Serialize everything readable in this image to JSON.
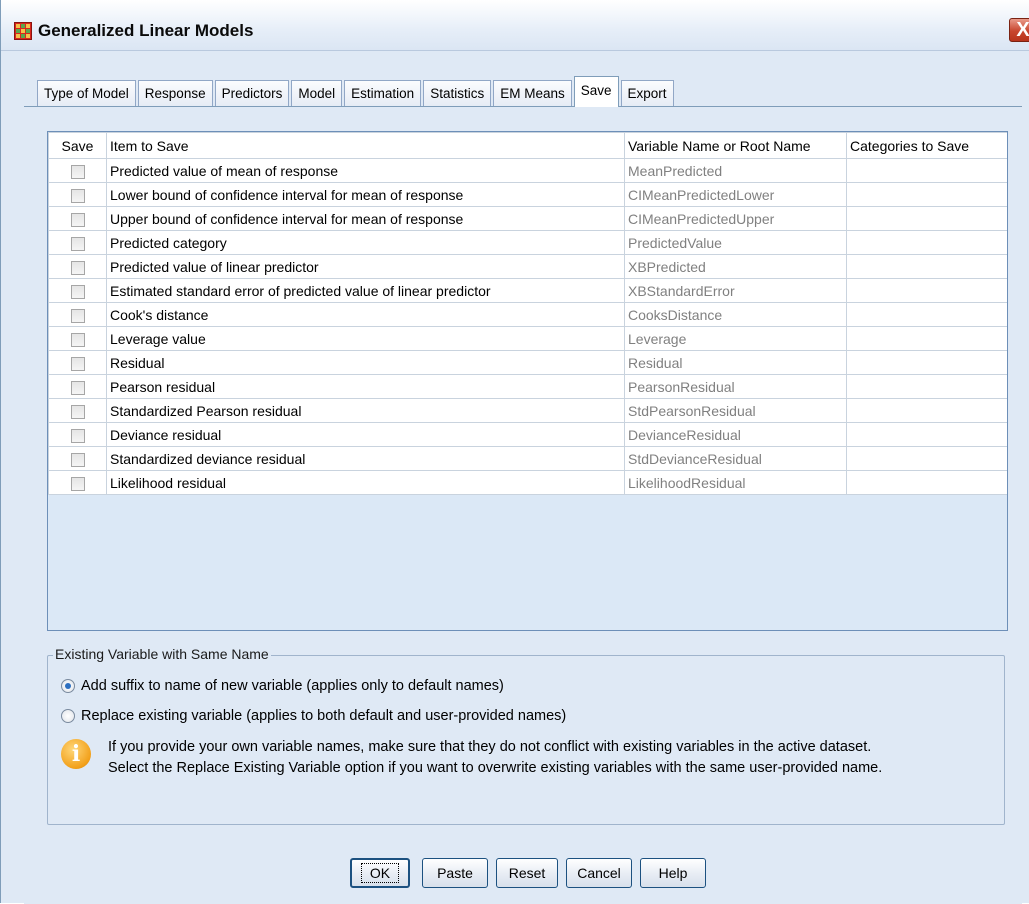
{
  "window": {
    "title": "Generalized Linear Models",
    "close_glyph": "X"
  },
  "tabs": [
    {
      "label": "Type of Model"
    },
    {
      "label": "Response"
    },
    {
      "label": "Predictors"
    },
    {
      "label": "Model"
    },
    {
      "label": "Estimation"
    },
    {
      "label": "Statistics"
    },
    {
      "label": "EM Means"
    },
    {
      "label": "Save",
      "active": true
    },
    {
      "label": "Export"
    }
  ],
  "grid": {
    "columns": [
      "Save",
      "Item to Save",
      "Variable Name or Root Name",
      "Categories to Save"
    ],
    "rows": [
      {
        "checked": false,
        "item": "Predicted value of mean of response",
        "variable": "MeanPredicted",
        "categories": ""
      },
      {
        "checked": false,
        "item": "Lower bound of confidence interval for mean of response",
        "variable": "CIMeanPredictedLower",
        "categories": ""
      },
      {
        "checked": false,
        "item": "Upper bound of confidence interval for mean of response",
        "variable": "CIMeanPredictedUpper",
        "categories": ""
      },
      {
        "checked": false,
        "item": "Predicted category",
        "variable": "PredictedValue",
        "categories": ""
      },
      {
        "checked": false,
        "item": "Predicted value of linear predictor",
        "variable": "XBPredicted",
        "categories": ""
      },
      {
        "checked": false,
        "item": "Estimated standard error of predicted value of linear predictor",
        "variable": "XBStandardError",
        "categories": ""
      },
      {
        "checked": false,
        "item": "Cook's distance",
        "variable": "CooksDistance",
        "categories": ""
      },
      {
        "checked": false,
        "item": "Leverage value",
        "variable": "Leverage",
        "categories": ""
      },
      {
        "checked": false,
        "item": "Residual",
        "variable": "Residual",
        "categories": ""
      },
      {
        "checked": false,
        "item": "Pearson residual",
        "variable": "PearsonResidual",
        "categories": ""
      },
      {
        "checked": false,
        "item": "Standardized Pearson residual",
        "variable": "StdPearsonResidual",
        "categories": ""
      },
      {
        "checked": false,
        "item": "Deviance residual",
        "variable": "DevianceResidual",
        "categories": ""
      },
      {
        "checked": false,
        "item": "Standardized deviance residual",
        "variable": "StdDevianceResidual",
        "categories": ""
      },
      {
        "checked": false,
        "item": "Likelihood residual",
        "variable": "LikelihoodResidual",
        "categories": ""
      }
    ]
  },
  "existing_variable": {
    "legend": "Existing Variable with Same Name",
    "option_add_suffix": {
      "label": "Add suffix to name of new variable (applies only to default names)",
      "selected": true
    },
    "option_replace": {
      "label": "Replace existing variable (applies to both default and user-provided names)",
      "selected": false
    },
    "info_line1": "If you provide your own variable names, make sure that they do not conflict with existing variables in the active dataset.",
    "info_line2": "Select the Replace Existing Variable option if you want to overwrite existing variables with the same user-provided name."
  },
  "buttons": {
    "ok": "OK",
    "paste": "Paste",
    "reset": "Reset",
    "cancel": "Cancel",
    "help": "Help"
  },
  "icons": {
    "app": "spss-data-grid-icon",
    "close": "close-icon",
    "info": "info-icon"
  }
}
